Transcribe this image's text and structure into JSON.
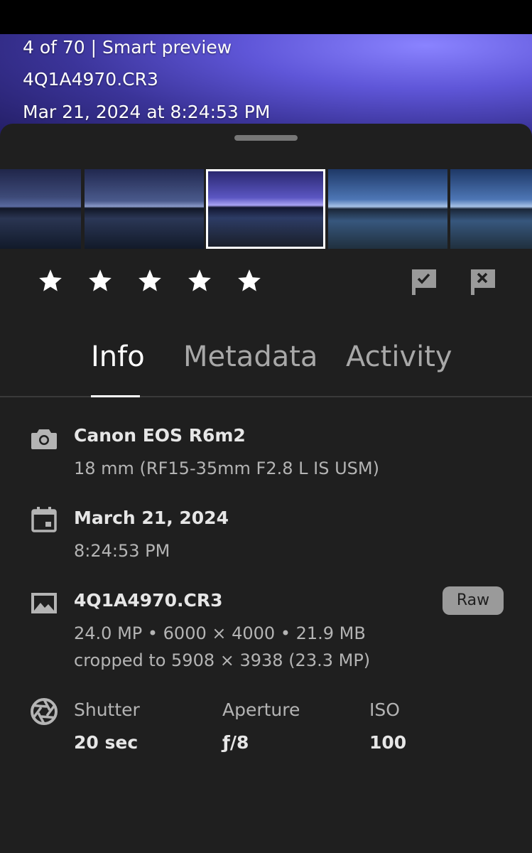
{
  "overlay": {
    "counter": "4 of 70 | Smart preview",
    "filename": "4Q1A4970.CR3",
    "datetime": "Mar 21, 2024 at 8:24:53 PM"
  },
  "filmstrip": {
    "count": 5,
    "selected_index": 2
  },
  "rating": {
    "stars": 5,
    "filled": 0
  },
  "flags": [
    {
      "icon": "pick-flag-icon"
    },
    {
      "icon": "reject-flag-icon"
    }
  ],
  "tabs": [
    {
      "label": "Info",
      "active": true
    },
    {
      "label": "Metadata",
      "active": false
    },
    {
      "label": "Activity",
      "active": false
    }
  ],
  "info": {
    "camera": {
      "icon": "camera-icon",
      "title": "Canon EOS R6m2",
      "subtitle": "18 mm (RF15-35mm F2.8 L IS USM)"
    },
    "date": {
      "icon": "calendar-icon",
      "title": "March 21, 2024",
      "subtitle": "8:24:53 PM"
    },
    "file": {
      "icon": "image-icon",
      "title": "4Q1A4970.CR3",
      "badge": "Raw",
      "line1": "24.0 MP • 6000 × 4000 • 21.9 MB",
      "line2": "cropped to 5908 × 3938 (23.3 MP)"
    },
    "exposure": {
      "icon": "aperture-icon",
      "shutter_label": "Shutter",
      "shutter_value": "20 sec",
      "aperture_label": "Aperture",
      "aperture_value": "ƒ/8",
      "iso_label": "ISO",
      "iso_value": "100"
    }
  },
  "colors": {
    "sheet_bg": "#1f1f1f",
    "text_primary": "#e6e6e6",
    "text_secondary": "#b4b4b4"
  }
}
